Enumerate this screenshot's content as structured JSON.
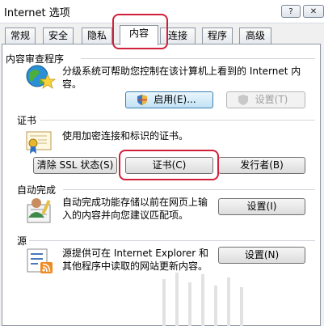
{
  "window": {
    "title": "Internet 选项",
    "help_label": "?",
    "close_label": "✕"
  },
  "tabs": [
    "常规",
    "安全",
    "隐私",
    "内容",
    "连接",
    "程序",
    "高级"
  ],
  "content_advisor": {
    "heading": "内容审查程序",
    "description": "分级系统可帮助您控制在该计算机上看到的 Internet 内容。",
    "enable_button": "启用(E)...",
    "settings_button": "设置(T)"
  },
  "certificates": {
    "heading": "证书",
    "description": "使用加密连接和标识的证书。",
    "clear_ssl_button": "清除 SSL 状态(S)",
    "certificates_button": "证书(C)",
    "publishers_button": "发行者(B)"
  },
  "autocomplete": {
    "heading": "自动完成",
    "description": "自动完成功能存储以前在网页上输入的内容并向您建议匹配项。",
    "settings_button": "设置(I)"
  },
  "feeds": {
    "heading": "源",
    "description": "源提供可在 Internet Explorer 和其他程序中读取的网站更新内容。",
    "settings_button": "设置(N)"
  },
  "colors": {
    "annotation": "#d0203a",
    "focus_border": "#3c7fb1"
  },
  "icons": [
    "globe-star-icon",
    "shield-icon",
    "certificate-icon",
    "autocomplete-user-icon",
    "feeds-icon"
  ]
}
